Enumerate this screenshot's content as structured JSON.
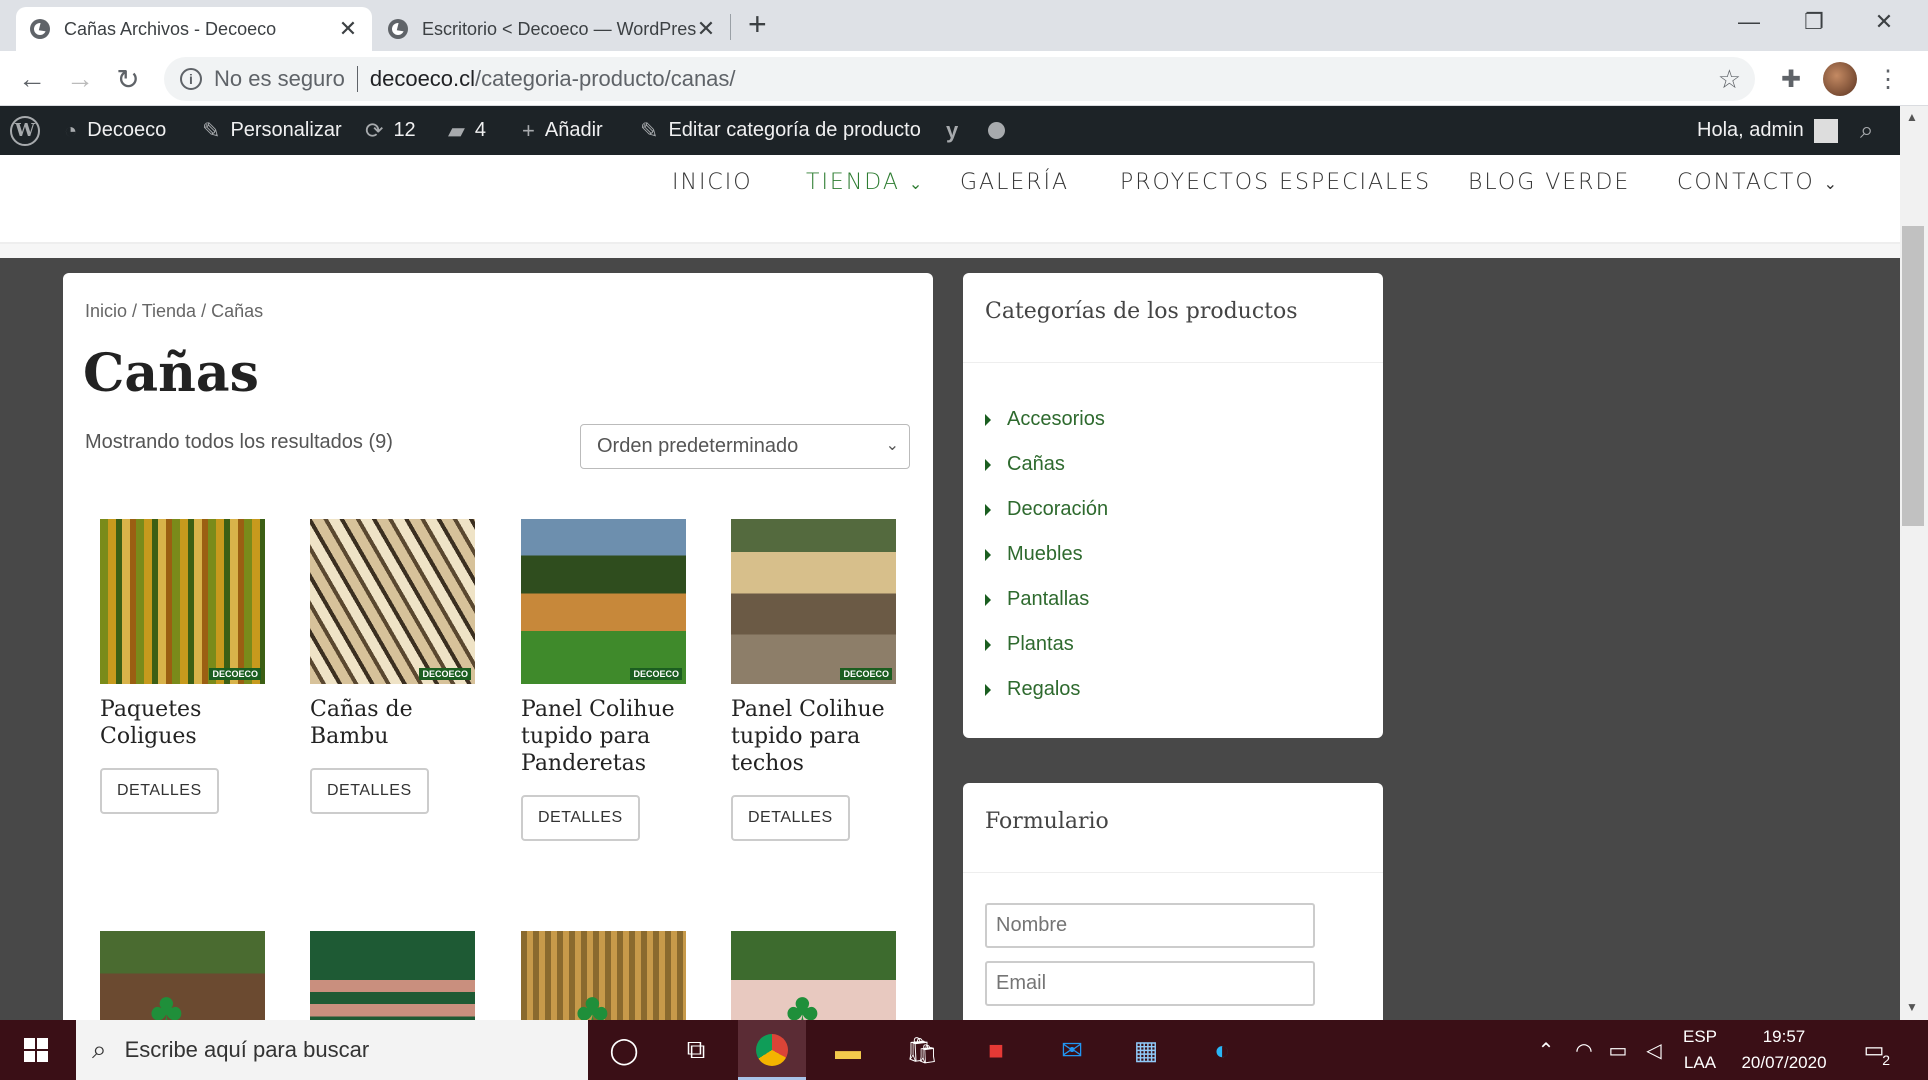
{
  "browser": {
    "tabs": [
      {
        "title": "Cañas Archivos - Decoeco",
        "active": true
      },
      {
        "title": "Escritorio < Decoeco — WordPress",
        "active": false
      }
    ],
    "new_tab": "+",
    "security": "No es seguro",
    "url_domain": "decoeco.cl",
    "url_path": "/categoria-producto/canas/"
  },
  "wpbar": {
    "site": "Decoeco",
    "customize": "Personalizar",
    "updates": "12",
    "comments": "4",
    "new": "Añadir",
    "edit": "Editar categoría de producto",
    "greeting": "Hola, admin"
  },
  "menu": [
    "INICIO",
    "TIENDA",
    "GALERÍA",
    "PROYECTOS ESPECIALES",
    "BLOG VERDE",
    "CONTACTO"
  ],
  "breadcrumb": "Inicio / Tienda / Cañas",
  "page_title": "Cañas",
  "result_count": "Mostrando todos los resultados (9)",
  "orderby": "Orden predeterminado",
  "products": [
    {
      "name": "Paquetes Coligues",
      "button": "DETALLES",
      "badge": "DECOECO"
    },
    {
      "name": "Cañas de Bambu",
      "button": "DETALLES",
      "badge": "DECOECO"
    },
    {
      "name": "Panel Colihue tupido para Panderetas",
      "button": "DETALLES",
      "badge": "DECOECO"
    },
    {
      "name": "Panel Colihue tupido para techos",
      "button": "DETALLES",
      "badge": "DECOECO"
    }
  ],
  "sidebar": {
    "categories_title": "Categorías de los productos",
    "categories": [
      "Accesorios",
      "Cañas",
      "Decoración",
      "Muebles",
      "Pantallas",
      "Plantas",
      "Regalos"
    ],
    "form_title": "Formulario",
    "form_name_placeholder": "Nombre",
    "form_email_placeholder": "Email"
  },
  "taskbar": {
    "search": "Escribe aquí para buscar",
    "lang1": "ESP",
    "lang2": "LAA",
    "time": "19:57",
    "date": "20/07/2020",
    "notif": "2"
  }
}
